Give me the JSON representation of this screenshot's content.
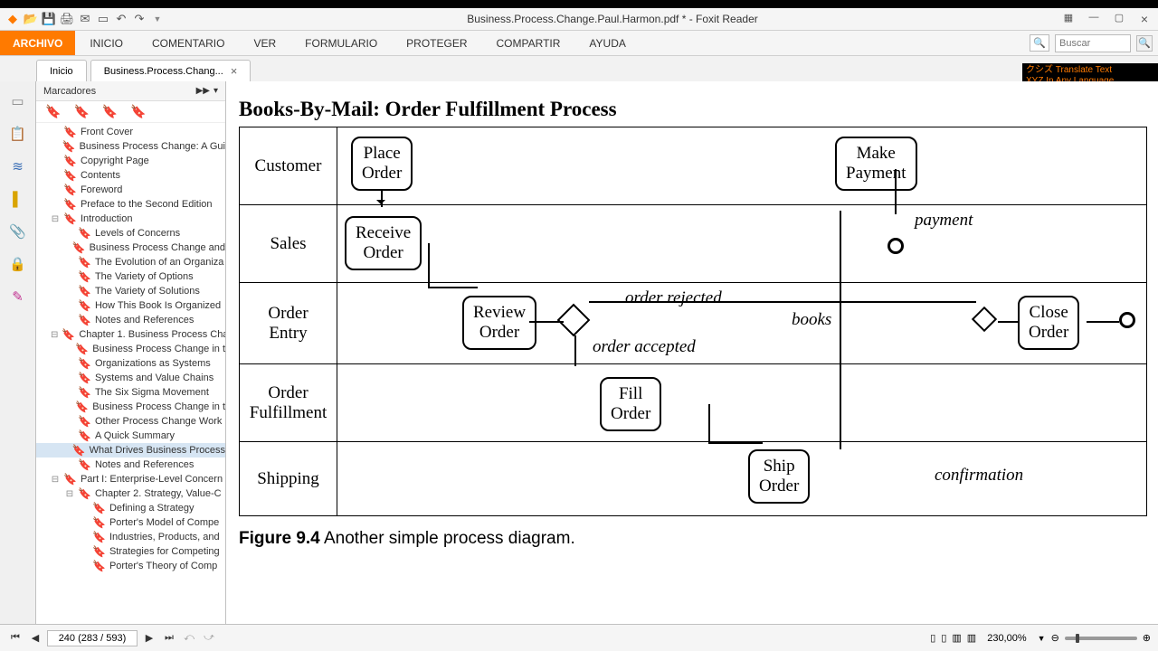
{
  "titlebar": {
    "title": "Business.Process.Change.Paul.Harmon.pdf * - Foxit Reader"
  },
  "menu": {
    "file": "ARCHIVO",
    "items": [
      "INICIO",
      "COMENTARIO",
      "VER",
      "FORMULARIO",
      "PROTEGER",
      "COMPARTIR",
      "AYUDA"
    ],
    "search_placeholder": "Buscar"
  },
  "tabs": {
    "home": "Inicio",
    "doc": "Business.Process.Chang..."
  },
  "bookmarks_panel": {
    "title": "Marcadores"
  },
  "bookmarks": [
    {
      "l": 1,
      "t": "Front Cover"
    },
    {
      "l": 1,
      "t": "Business Process Change: A Gui"
    },
    {
      "l": 1,
      "t": "Copyright Page"
    },
    {
      "l": 1,
      "t": "Contents"
    },
    {
      "l": 1,
      "t": "Foreword"
    },
    {
      "l": 1,
      "t": "Preface to the Second Edition"
    },
    {
      "l": 1,
      "t": "Introduction",
      "exp": true
    },
    {
      "l": 2,
      "t": "Levels of Concerns"
    },
    {
      "l": 2,
      "t": "Business Process Change and"
    },
    {
      "l": 2,
      "t": "The Evolution of an Organiza"
    },
    {
      "l": 2,
      "t": "The Variety of Options"
    },
    {
      "l": 2,
      "t": "The Variety of Solutions"
    },
    {
      "l": 2,
      "t": "How This Book Is Organized"
    },
    {
      "l": 2,
      "t": "Notes and References"
    },
    {
      "l": 1,
      "t": "Chapter 1. Business Process Cha",
      "exp": true
    },
    {
      "l": 2,
      "t": "Business Process Change in t"
    },
    {
      "l": 2,
      "t": "Organizations as Systems"
    },
    {
      "l": 2,
      "t": "Systems and Value Chains"
    },
    {
      "l": 2,
      "t": "The Six Sigma Movement"
    },
    {
      "l": 2,
      "t": "Business Process Change in t"
    },
    {
      "l": 2,
      "t": "Other Process Change Work"
    },
    {
      "l": 2,
      "t": "A Quick Summary"
    },
    {
      "l": 2,
      "t": "What Drives Business Process",
      "sel": true
    },
    {
      "l": 2,
      "t": "Notes and References"
    },
    {
      "l": 1,
      "t": "Part I: Enterprise-Level Concern",
      "exp": true
    },
    {
      "l": 2,
      "t": "Chapter 2. Strategy, Value-C",
      "exp": true
    },
    {
      "l": 3,
      "t": "Defining a Strategy"
    },
    {
      "l": 3,
      "t": "Porter's Model of Compe"
    },
    {
      "l": 3,
      "t": "Industries, Products, and"
    },
    {
      "l": 3,
      "t": "Strategies for Competing"
    },
    {
      "l": 3,
      "t": "Porter's Theory of Comp"
    }
  ],
  "diagram": {
    "title": "Books-By-Mail: Order Fulfillment Process",
    "lanes": [
      "Customer",
      "Sales",
      "Order\nEntry",
      "Order\nFulfillment",
      "Shipping"
    ],
    "tasks": {
      "place": "Place\nOrder",
      "receive": "Receive\nOrder",
      "review": "Review\nOrder",
      "fill": "Fill\nOrder",
      "ship": "Ship\nOrder",
      "make": "Make\nPayment",
      "close": "Close\nOrder"
    },
    "labels": {
      "rej": "order rejected",
      "acc": "order accepted",
      "books": "books",
      "payment": "payment",
      "conf": "confirmation"
    },
    "caption_b": "Figure 9.4",
    "caption_t": "  Another simple process diagram."
  },
  "status": {
    "page": "240 (283 / 593)",
    "zoom": "230,00%"
  },
  "ad": {
    "l1": "クシズ Translate Text",
    "l2": "XYZ   In Any Language"
  }
}
